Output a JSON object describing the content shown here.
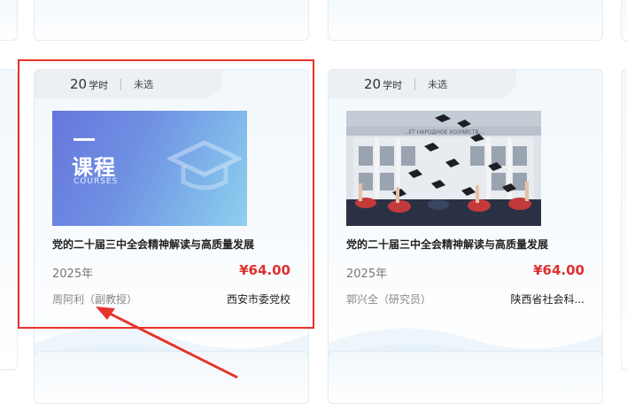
{
  "colors": {
    "accent_red": "#e8332c",
    "price_red": "#e0302e",
    "card_bg": "#f2f8fc"
  },
  "icons": [
    "graduation-cap-icon",
    "arrow-annotation"
  ],
  "cards": [
    {
      "hours": "20",
      "hours_unit": "学时",
      "status": "未选",
      "thumb_big": "课程",
      "thumb_small": "COURSES",
      "title": "党的二十届三中全会精神解读与高质量发展",
      "year": "2025年",
      "price": "¥64.00",
      "teacher": "周阿利（副教授）",
      "org": "西安市委党校"
    },
    {
      "hours": "20",
      "hours_unit": "学时",
      "status": "未选",
      "thumb_banner": "...ЕТ НАРОДНОЕ ХОЗЯЙСТВ...",
      "title": "党的二十届三中全会精神解读与高质量发展",
      "year": "2025年",
      "price": "¥64.00",
      "teacher": "郭兴全（研究员）",
      "org": "陕西省社会科..."
    }
  ]
}
